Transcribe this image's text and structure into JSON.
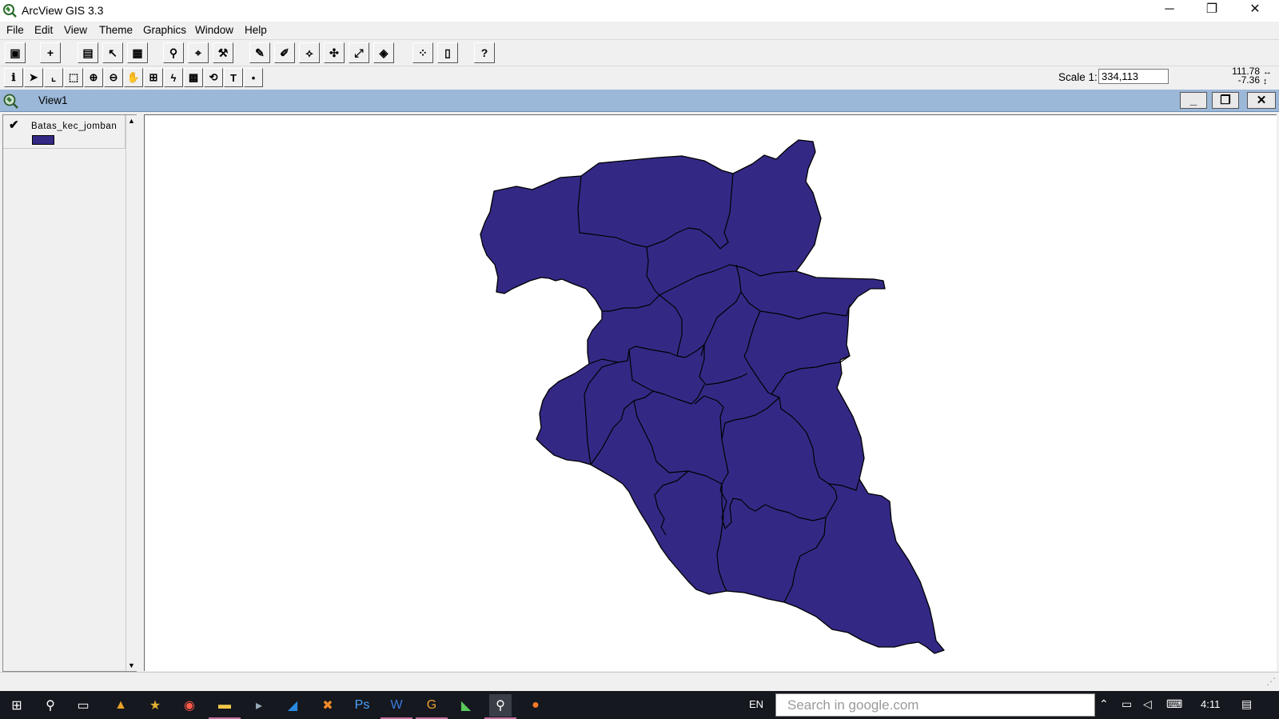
{
  "window": {
    "title": "ArcView GIS 3.3",
    "minimize": "─",
    "restore": "❐",
    "close": "✕"
  },
  "menu": {
    "items": [
      "File",
      "Edit",
      "View",
      "Theme",
      "Graphics",
      "Window",
      "Help"
    ]
  },
  "toolbar": {
    "scale_label": "Scale 1:",
    "scale_value": "334,113",
    "coord_x": "111.78",
    "coord_y": "-7.36"
  },
  "view": {
    "title": "View1",
    "minimize": "_",
    "restore": "❐",
    "close": "✕"
  },
  "toc": {
    "themes": [
      {
        "name": "Batas_kec_jomban",
        "visible": true,
        "fill_color": "#332985"
      }
    ]
  },
  "map": {
    "fill_color": "#332985",
    "outline_color": "#000000",
    "background_color": "#ffffff"
  },
  "taskbar": {
    "language": "EN",
    "search_placeholder": "Search in google.com",
    "time": "4:11",
    "apps": [
      "start-icon",
      "search-icon",
      "task-view-icon",
      "chart-app-icon",
      "star-app-icon",
      "media-app-icon",
      "file-explorer-icon",
      "terminal-icon",
      "vscode-icon",
      "xampp-icon",
      "photoshop-icon",
      "word-icon",
      "google-app-icon",
      "map-app-icon",
      "arcview-icon",
      "firefox-icon"
    ]
  }
}
